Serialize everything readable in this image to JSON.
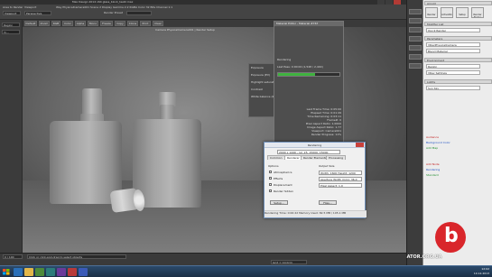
{
  "window": {
    "title": "Max Design 2014 x64   glass_block_test2.max",
    "viewport_label": "Camera PhysicalCamera001 | Render Setup"
  },
  "ribbon": {
    "area_to_render": "Area to Render",
    "render_target": "Viewport",
    "physical_camera": "Way PhysicalCamera001  Scene 2  Display Gamma 2.2  RGBA Color 32 Bits Channel 1:1",
    "view": "Perspective",
    "view_label": "Viewport",
    "preset_label": "Render Preset"
  },
  "left_panel": {
    "title": "Area to Render",
    "value": "Region",
    "value2": "Vi..."
  },
  "toolbar": {
    "buttons": [
      "Default",
      "Zoom",
      "RGB",
      "Color",
      "Alpha",
      "Mono",
      "Freeze",
      "Copy",
      "Clone",
      "Print",
      "Clear"
    ]
  },
  "exposure": {
    "title": "Exposure",
    "rows": [
      {
        "label": "Exposure (EV)",
        "value": "1.0"
      },
      {
        "label": "Highlight saturation",
        "value": "0.5"
      },
      {
        "label": "Contrast",
        "value": "1.0"
      },
      {
        "label": "White balance (K)",
        "value": "6500"
      }
    ]
  },
  "material_editor": {
    "title": "Material Editor - Material #767",
    "line_rendering": "Rendering",
    "line_pass": "Last Pass: 0:00:00 (1,548 / 2,440)",
    "stats": [
      "Last Frame Time: 0:05:00",
      "Elapsed Time: 0:01:49",
      "Time Remaining: 0:03:11",
      "Frame#: 0",
      "Pixel Aspect Ratio: 1.0000",
      "Image Aspect Ratio: 1.77",
      "Viewport: Camera001",
      "Render Progress: 11%"
    ],
    "progress": 0.6
  },
  "render_dialog": {
    "title": "Rendering",
    "field_top": "2000 x 1440 - 12, 25, 15000, 15000",
    "tabs": [
      "Common",
      "Renderer",
      "Render Elements",
      "Processing"
    ],
    "section_label": "Options",
    "checkboxes": [
      "Atmospherics",
      "Effects",
      "Displacement",
      "Render hidden"
    ],
    "output_label": "Output Size",
    "output_value": "Width: 1600  Height: 1200",
    "aperture": "Aperture Width (mm): 36.0",
    "pixel_aspect": "Pixel Aspect: 1.0",
    "buttons": [
      "Setup...",
      "Files..."
    ],
    "footer": "Rendering Time: 0:00:22   Memory Used: 82.5 MB / 105.1 MB"
  },
  "right_panel": {
    "headers": [
      "Arnold",
      "Modifier List",
      "Parameters",
      "Environment",
      "Lights"
    ],
    "buttons": [
      "Render",
      "ActiveShade",
      "Setup",
      "Render Frame"
    ],
    "fields": [
      "Quick Render",
      "VRayPhysicalCamera",
      "Blend Material",
      "Region",
      "VRay Settings",
      "Sun Sky"
    ],
    "items_red": [
      "Audience",
      "Add Node"
    ],
    "items_blue": [
      "Background  Color",
      "Rendering"
    ],
    "items_green": [
      "Add Map",
      "Standard"
    ]
  },
  "bottom": {
    "frame": "0 / 100",
    "status": "Click or click-and-drag to select objects",
    "grid": "Grid = 10.0cm"
  },
  "brand": {
    "watermark": "WWW.INCUBATOR.ORG.UA",
    "logo_letter": "b",
    "logo_color": "#d9262b"
  },
  "taskbar": {
    "time": "12:02",
    "date": "10.12.2013"
  }
}
